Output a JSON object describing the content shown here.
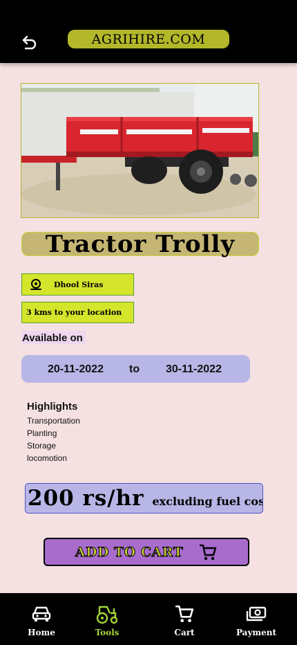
{
  "header": {
    "brand": "AGRIHIRE.COM",
    "back_icon": "undo-arrow-icon"
  },
  "product": {
    "title": "Tractor Trolly",
    "location": "Dhool Siras",
    "location_icon": "map-pin-icon",
    "distance": "3 kms to your location",
    "available_label": "Available on",
    "date_from": "20-11-2022",
    "date_sep": "to",
    "date_to": "30-11-2022",
    "highlights_title": "Highlights",
    "highlights": [
      "Transportation",
      "Planting",
      "Storage",
      "locomotion"
    ],
    "price": "200 rs/hr",
    "price_note": "excluding fuel cost"
  },
  "actions": {
    "add_to_cart": "ADD TO CART",
    "cart_icon": "shopping-cart-icon"
  },
  "bottom_nav": {
    "active": "Tools",
    "items": [
      {
        "label": "Home",
        "icon": "car-icon"
      },
      {
        "label": "Tools",
        "icon": "tractor-icon"
      },
      {
        "label": "Cart",
        "icon": "shopping-cart-icon"
      },
      {
        "label": "Payment",
        "icon": "cash-icon"
      }
    ]
  },
  "colors": {
    "accent": "#b3b72a",
    "tag_bg": "#d5e52b",
    "date_bg": "#b7b6e6",
    "cart_button": "#a86ccd",
    "nav_active": "#a4d63a",
    "page_bg": "#f5e1e1"
  }
}
